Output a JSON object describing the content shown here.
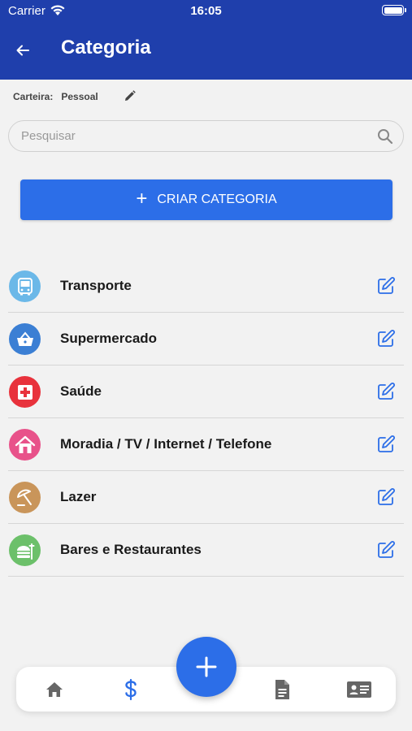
{
  "status_bar": {
    "carrier": "Carrier",
    "time": "16:05"
  },
  "header": {
    "title": "Categoria"
  },
  "wallet": {
    "label": "Carteira:",
    "name": "Pessoal"
  },
  "search": {
    "placeholder": "Pesquisar",
    "value": ""
  },
  "create_button": {
    "label": "CRIAR CATEGORIA"
  },
  "categories": [
    {
      "name": "Transporte",
      "icon": "bus-icon",
      "color": "#6bb8e8"
    },
    {
      "name": "Supermercado",
      "icon": "basket-icon",
      "color": "#3b7fd4"
    },
    {
      "name": "Saúde",
      "icon": "first-aid-icon",
      "color": "#e8323c"
    },
    {
      "name": "Moradia / TV / Internet / Telefone",
      "icon": "house-icon",
      "color": "#e8528a"
    },
    {
      "name": "Lazer",
      "icon": "umbrella-icon",
      "color": "#c9955a"
    },
    {
      "name": "Bares e Restaurantes",
      "icon": "food-icon",
      "color": "#6cc06a"
    }
  ],
  "bottom_nav": {
    "items": [
      "home-icon",
      "dollar-icon",
      "add-icon",
      "document-icon",
      "contact-card-icon"
    ],
    "active": "dollar-icon",
    "active_color": "#2c6ee8",
    "inactive_color": "#666666"
  },
  "colors": {
    "header": "#1f3fac",
    "accent": "#2c6ee8",
    "edit": "#2c6ee8"
  }
}
